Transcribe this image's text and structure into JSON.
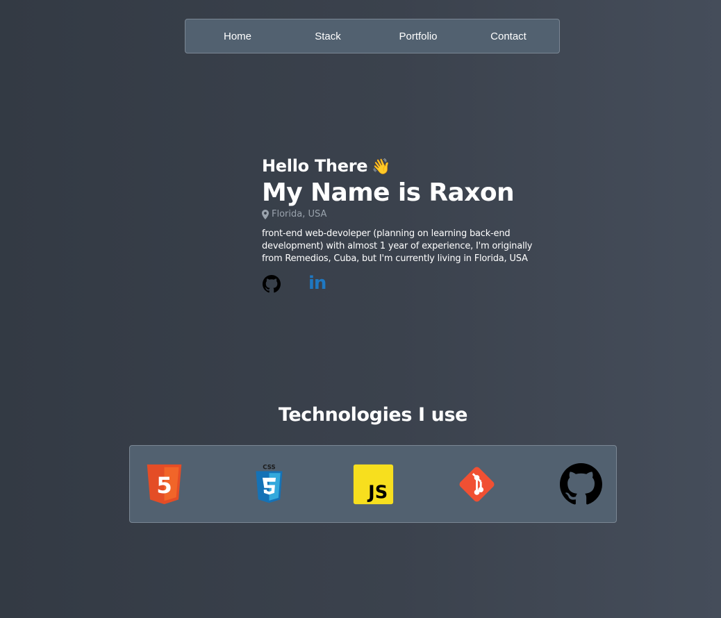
{
  "nav": {
    "links": [
      {
        "label": "Home"
      },
      {
        "label": "Stack"
      },
      {
        "label": "Portfolio"
      },
      {
        "label": "Contact"
      }
    ]
  },
  "hero": {
    "greeting": "Hello There",
    "wave_emoji": "👋",
    "name": "My Name is Raxon",
    "location": "Florida, USA",
    "bio": "front-end web-devoleper (planning on learning back-end development) with almost 1 year of experience, I'm originally from Remedios, Cuba, but I'm currently living in Florida, USA",
    "socials": [
      {
        "icon": "github-icon"
      },
      {
        "icon": "linkedin-icon",
        "text": "in"
      }
    ]
  },
  "technologies": {
    "title": "Technologies I use",
    "items": [
      {
        "icon": "html5-icon",
        "label": "5"
      },
      {
        "icon": "css3-icon",
        "label": "CSS"
      },
      {
        "icon": "javascript-icon",
        "label": "JS"
      },
      {
        "icon": "git-icon"
      },
      {
        "icon": "github-icon"
      }
    ]
  },
  "colors": {
    "background": "#3b424d",
    "panel": "#526170",
    "linkedin": "#1f78c2",
    "html5": "#e44d26",
    "css3": "#1572b6",
    "javascript": "#f7df1e",
    "git": "#f05033"
  }
}
